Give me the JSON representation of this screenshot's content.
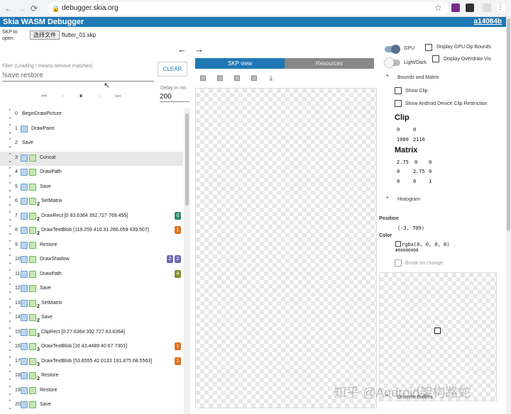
{
  "browser": {
    "url": "debugger.skia.org",
    "nav_icons": [
      "back-icon",
      "forward-icon",
      "reload-icon"
    ]
  },
  "app": {
    "title": "Skia WASM Debugger",
    "version": "a14084b"
  },
  "file": {
    "label": "SKP to open:",
    "button": "选择文件",
    "name": "flutter_01.skp"
  },
  "filter": {
    "label": "Filter (Leading ! means remove matches)",
    "value": "!save restore",
    "clear": "CLEAR"
  },
  "playback": {
    "delay_label": "Delay in ms",
    "delay_value": "200",
    "controls": [
      "first",
      "prev",
      "pause",
      "next",
      "last"
    ]
  },
  "commands": [
    {
      "index": "0",
      "name": "BeginDrawPicture",
      "icons": 0,
      "sub": "",
      "badges": []
    },
    {
      "index": "1",
      "name": "DrawPaint",
      "icons": 1,
      "sub": "",
      "badges": []
    },
    {
      "index": "2",
      "name": "Save",
      "icons": 0,
      "sub": "",
      "badges": []
    },
    {
      "index": "3",
      "name": "Concat",
      "icons": 2,
      "sub": "",
      "badges": [],
      "selected": true
    },
    {
      "index": "4",
      "name": "DrawPath",
      "icons": 2,
      "sub": "",
      "badges": []
    },
    {
      "index": "5",
      "name": "Save",
      "icons": 2,
      "sub": "",
      "badges": []
    },
    {
      "index": "6",
      "name": "SetMatrix",
      "icons": 2,
      "sub": "2",
      "badges": []
    },
    {
      "index": "7",
      "name": "DrawRect [0 83.6364 392.727 769.455]",
      "icons": 2,
      "sub": "2",
      "badges": [
        {
          "text": "0",
          "color": "#2e8b6a"
        }
      ]
    },
    {
      "index": "8",
      "name": "DrawTextBlob [119.259 410.31 286.059 439.507]",
      "icons": 2,
      "sub": "2",
      "badges": [
        {
          "text": "1",
          "color": "#e0701e"
        }
      ]
    },
    {
      "index": "9",
      "name": "Restore",
      "icons": 2,
      "sub": "",
      "badges": []
    },
    {
      "index": "10",
      "name": "DrawShadow",
      "icons": 2,
      "sub": "",
      "badges": [
        {
          "text": "2",
          "color": "#6c6ab4"
        },
        {
          "text": "2",
          "color": "#6c6ab4"
        }
      ]
    },
    {
      "index": "11",
      "name": "DrawPath",
      "icons": 2,
      "sub": "",
      "badges": [
        {
          "text": "4",
          "color": "#8a8a2e"
        }
      ]
    },
    {
      "index": "12",
      "name": "Save",
      "icons": 2,
      "sub": "",
      "badges": []
    },
    {
      "index": "13",
      "name": "SetMatrix",
      "icons": 2,
      "sub": "2",
      "badges": []
    },
    {
      "index": "14",
      "name": "Save",
      "icons": 2,
      "sub": "2",
      "badges": []
    },
    {
      "index": "15",
      "name": "ClipRect [0 27.6364 392.727 83.6364]",
      "icons": 2,
      "sub": "3",
      "badges": []
    },
    {
      "index": "16",
      "name": "DrawTextBlob [16 43.4489 40 67.7301]",
      "icons": 2,
      "sub": "3",
      "badges": [
        {
          "text": "1",
          "color": "#e0701e"
        }
      ]
    },
    {
      "index": "17",
      "name": "DrawTextBlob [53.8555 42.0133 191.875 68.5563]",
      "icons": 2,
      "sub": "3",
      "badges": [
        {
          "text": "1",
          "color": "#e0701e"
        }
      ]
    },
    {
      "index": "18",
      "name": "Restore",
      "icons": 2,
      "sub": "2",
      "badges": []
    },
    {
      "index": "19",
      "name": "Restore",
      "icons": 2,
      "sub": "",
      "badges": []
    },
    {
      "index": "20",
      "name": "Save",
      "icons": 2,
      "sub": "",
      "badges": []
    }
  ],
  "tabs": {
    "skp": "SKP view",
    "resources": "Resources"
  },
  "view_buttons": [
    "image-icon",
    "image-icon",
    "image-icon",
    "image-icon",
    "download-icon"
  ],
  "right": {
    "gpu": "GPU",
    "gpu_on": true,
    "light_dark": "Light/Dark",
    "gpu_op_bounds": "Display GPU Op Bounds",
    "overdraw": "Display Overdraw Vis",
    "bounds_and_matrix": "Bounds and Matrix",
    "show_clip": "Show Clip",
    "show_android_clip": "Show Android Device Clip Restriction",
    "clip_title": "Clip",
    "clip_rows": [
      [
        "0",
        "0"
      ],
      [
        "1080",
        "2116"
      ]
    ],
    "matrix_title": "Matrix",
    "matrix_rows": [
      [
        "2.75",
        "0",
        "0"
      ],
      [
        "0",
        "2.75",
        "0"
      ],
      [
        "0",
        "0",
        "1"
      ]
    ],
    "histogram": "Histogram",
    "position_label": "Position",
    "position_value": "(-3, 709)",
    "color_label": "Color",
    "color_rgba": "rgba(0, 0, 0, 0)",
    "color_hex": "#00000000",
    "break_on_change": "Break on change.",
    "discrete_buffers": "Discrete Buffers"
  },
  "watermark": "知乎 @Android架构路蛇"
}
